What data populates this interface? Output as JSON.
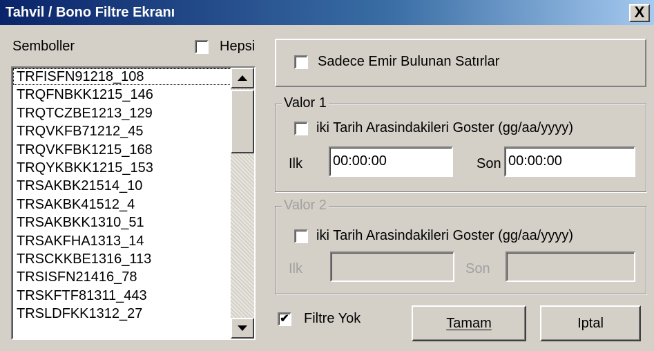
{
  "window": {
    "title": "Tahvil / Bono Filtre Ekranı",
    "close_label": "X"
  },
  "symbols": {
    "label": "Semboller",
    "all_label": "Hepsi",
    "all_checked": false,
    "items": [
      "TRFISFN91218_108",
      "TRQFNBKK1215_146",
      "TRQTCZBE1213_129",
      "TRQVKFB71212_45",
      "TRQVKFBK1215_168",
      "TRQYKBKK1215_153",
      "TRSAKBK21514_10",
      "TRSAKBK41512_4",
      "TRSAKBKK1310_51",
      "TRSAKFHA1313_14",
      "TRSCKKBE1316_113",
      "TRSISFN21416_78",
      "TRSKFTF81311_443",
      "TRSLDFKK1312_27"
    ]
  },
  "only_orders": {
    "label": "Sadece Emir Bulunan Satırlar",
    "checked": false
  },
  "valor1": {
    "legend": "Valor 1",
    "range_label": "iki Tarih Arasindakileri Goster (gg/aa/yyyy)",
    "checked": false,
    "start_label": "Ilk",
    "start_value": "00:00:00",
    "end_label": "Son",
    "end_value": "00:00:00"
  },
  "valor2": {
    "legend": "Valor 2",
    "range_label": "iki Tarih Arasindakileri Goster (gg/aa/yyyy)",
    "checked": false,
    "start_label": "Ilk",
    "start_value": "",
    "end_label": "Son",
    "end_value": ""
  },
  "no_filter": {
    "label": "Filtre Yok",
    "checked_mark": "✔"
  },
  "buttons": {
    "ok": "Tamam",
    "cancel": "Iptal"
  },
  "colors": {
    "face": "#d4d0c8",
    "title_start": "#0a246a",
    "title_end": "#a6caf0",
    "disabled_text": "#a0a0a0"
  }
}
